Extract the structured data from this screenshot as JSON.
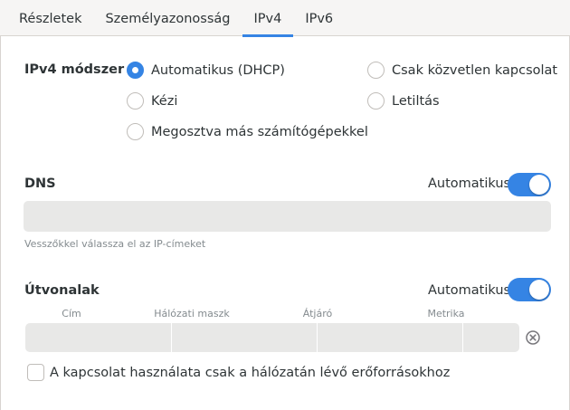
{
  "tabs": [
    {
      "label": "Részletek",
      "active": false
    },
    {
      "label": "Személyazonosság",
      "active": false
    },
    {
      "label": "IPv4",
      "active": true
    },
    {
      "label": "IPv6",
      "active": false
    }
  ],
  "ipv4": {
    "method_label": "IPv4 módszer",
    "options": [
      {
        "label": "Automatikus (DHCP)",
        "checked": true
      },
      {
        "label": "Kézi",
        "checked": false
      },
      {
        "label": "Megosztva más számítógépekkel",
        "checked": false
      },
      {
        "label": "Csak közvetlen kapcsolat",
        "checked": false
      },
      {
        "label": "Letiltás",
        "checked": false
      }
    ]
  },
  "dns": {
    "label": "DNS",
    "auto_label": "Automatikus",
    "auto_enabled": true,
    "value": "",
    "hint": "Vesszőkkel válassza el az IP-címeket"
  },
  "routes": {
    "label": "Útvonalak",
    "auto_label": "Automatikus",
    "auto_enabled": true,
    "columns": [
      "Cím",
      "Hálózati maszk",
      "Átjáró",
      "Metrika"
    ],
    "row": {
      "address": "",
      "netmask": "",
      "gateway": "",
      "metric": ""
    }
  },
  "local_only": {
    "label": "A kapcsolat használata csak a hálózatán lévő erőforrásokhoz",
    "checked": false
  },
  "colors": {
    "accent": "#3584e4"
  }
}
